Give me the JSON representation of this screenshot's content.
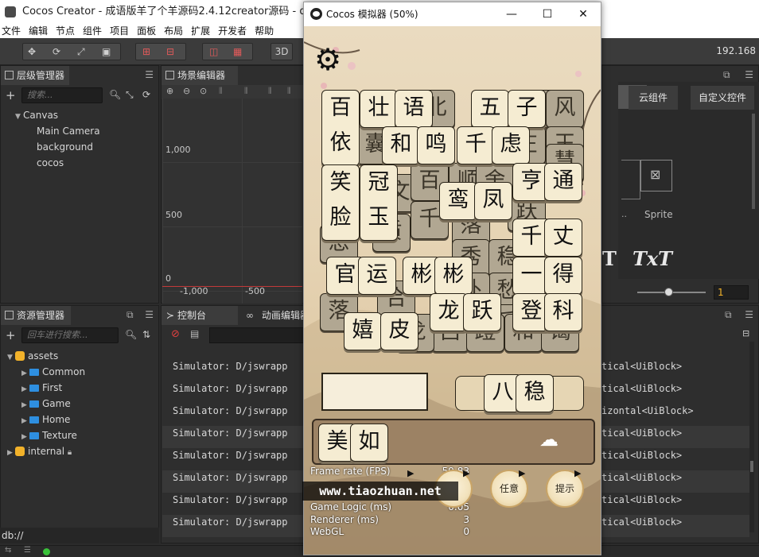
{
  "window": {
    "title": "Cocos Creator - 成语版羊了个羊源码2.4.12creator源码 - db://assets"
  },
  "menu": [
    "文件",
    "编辑",
    "节点",
    "组件",
    "项目",
    "面板",
    "布局",
    "扩展",
    "开发者",
    "帮助"
  ],
  "toolbar": {
    "mode_3d": "3D",
    "ip": "192.168"
  },
  "hierarchy": {
    "title": "层级管理器",
    "search_placeholder": "搜索...",
    "nodes": [
      {
        "label": "Canvas"
      },
      {
        "label": "Main Camera"
      },
      {
        "label": "background"
      },
      {
        "label": "cocos"
      }
    ]
  },
  "scene": {
    "title": "场景编辑器",
    "y_labels": [
      "1,000",
      "500",
      "0"
    ],
    "x_labels": [
      "-1,000",
      "-500"
    ]
  },
  "assets": {
    "title": "资源管理器",
    "search_placeholder": "回车进行搜索...",
    "items": [
      {
        "label": "assets"
      },
      {
        "label": "Common"
      },
      {
        "label": "First"
      },
      {
        "label": "Game"
      },
      {
        "label": "Home"
      },
      {
        "label": "Texture"
      },
      {
        "label": "internal"
      }
    ],
    "footer": "db://"
  },
  "console": {
    "tab_console": "控制台",
    "tab_anim": "动画编辑器",
    "prefix": "Simulator: D/jswrapp",
    "suffixes": [
      "tical<UiBlock>",
      "tical<UiBlock>",
      "izontal<UiBlock>",
      "tical<UiBlock>",
      "tical<UiBlock>",
      "tical<UiBlock>",
      "tical<UiBlock>",
      "tical<UiBlock>"
    ]
  },
  "right_panel": {
    "tab_cloud": "云组件",
    "tab_custom": "自定义控件",
    "sprite_label": "Sprite",
    "txt_label": "TxT",
    "t_label": "T",
    "field_value": "1"
  },
  "simulator": {
    "title": "Cocos 模拟器 (50%)",
    "min": "—",
    "max": "☐",
    "close": "✕",
    "tiles_dim": [
      "北",
      "武",
      "风",
      "囊",
      "庄",
      "王",
      "慧",
      "文",
      "百",
      "顺",
      "舍",
      "跃",
      "质",
      "落",
      "千",
      "恩",
      "秀",
      "稳",
      "愁",
      "外",
      "后",
      "落",
      "合",
      "吕",
      "蹬",
      "和",
      "谒",
      "龙"
    ],
    "tiles": [
      "百",
      "依",
      "壮",
      "语",
      "五",
      "子",
      "和",
      "鸣",
      "千",
      "虑",
      "笑",
      "脸",
      "冠",
      "玉",
      "鸾",
      "凤",
      "亨",
      "通",
      "千",
      "丈",
      "官",
      "运",
      "彬",
      "彬",
      "一",
      "得",
      "龙",
      "跃",
      "登",
      "科",
      "嬉",
      "皮"
    ],
    "slot_tiles": [
      "八",
      "稳"
    ],
    "bottom_tiles": [
      "美",
      "如"
    ],
    "buttons": [
      "任意",
      "提示"
    ],
    "stats": [
      {
        "label": "Frame rate (FPS)",
        "value": "59.83"
      },
      {
        "label": "Game Logic (ms)",
        "value": "0.05"
      },
      {
        "label": "Renderer (ms)",
        "value": "3"
      },
      {
        "label": "WebGL",
        "value": "0"
      }
    ]
  },
  "watermark": "www.tiaozhuan.net"
}
